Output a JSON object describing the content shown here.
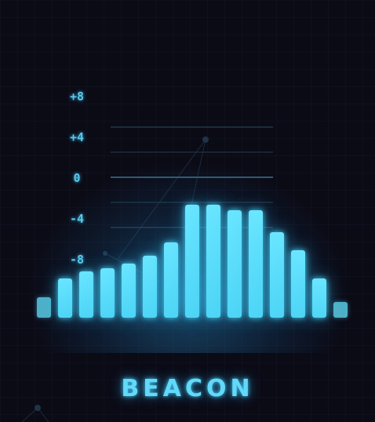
{
  "brand": {
    "name": "BEACON"
  },
  "scale": {
    "labels": [
      "+8",
      "+4",
      "0",
      "-4",
      "-8"
    ]
  },
  "equalizer": {
    "bar_levels": [
      0.16,
      0.3,
      0.36,
      0.38,
      0.42,
      0.48,
      0.58,
      0.87,
      0.87,
      0.83,
      0.83,
      0.66,
      0.52,
      0.3,
      0.12
    ],
    "dim_bars": [
      0,
      14
    ]
  },
  "colors": {
    "background": "#0b0b16",
    "accent": "#59c8ea",
    "bar": "#5ad8f7"
  }
}
